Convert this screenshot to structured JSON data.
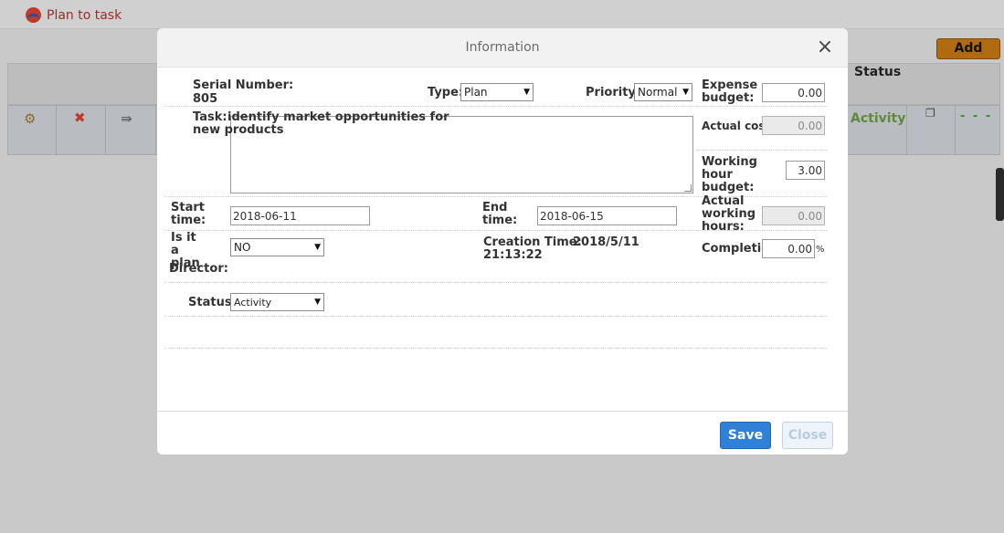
{
  "background": {
    "app_title": "Plan to task",
    "add_label": "Add",
    "status_header": "Status",
    "row": {
      "status": "Activity",
      "dashes": "- - -"
    }
  },
  "dialog": {
    "title": "Information",
    "close_glyph": "×",
    "serial_number_label": "Serial Number:",
    "serial_number_value": "805",
    "type_label": "Type:",
    "type_value": "Plan",
    "priority_label": "Priority:",
    "priority_value": "Normal",
    "expense_budget_label": "Expense budget:",
    "expense_budget_value": "0.00",
    "task_label": "Task:",
    "task_value": "identify market opportunities for new products",
    "actual_cost_label": "Actual cost:",
    "actual_cost_value": "0.00",
    "working_hour_budget_label": "Working hour budget:",
    "working_hour_budget_value": "3.00",
    "start_time_label": "Start time:",
    "start_time_value": "2018-06-11",
    "end_time_label": "End time:",
    "end_time_value": "2018-06-15",
    "actual_working_hours_label": "Actual working hours:",
    "actual_working_hours_value": "0.00",
    "is_plan_label": "Is it a plan",
    "is_plan_value": "NO",
    "creation_time_label": "Creation Time:",
    "creation_time_value": "2018/5/11 21:13:22",
    "completion_label": "Completion:",
    "completion_value": "0.00",
    "completion_unit": "%",
    "director_label": "Director:",
    "status_label": "Status:",
    "status_value": "Activity",
    "save_label": "Save",
    "close_label": "Close"
  },
  "colors": {
    "primary_button": "#2f80d6",
    "overlay": "#c9c9c9",
    "status_green": "#5e8a3a"
  },
  "icons": [
    "settings-icon",
    "delete-icon",
    "move-icon",
    "copy-icon"
  ]
}
